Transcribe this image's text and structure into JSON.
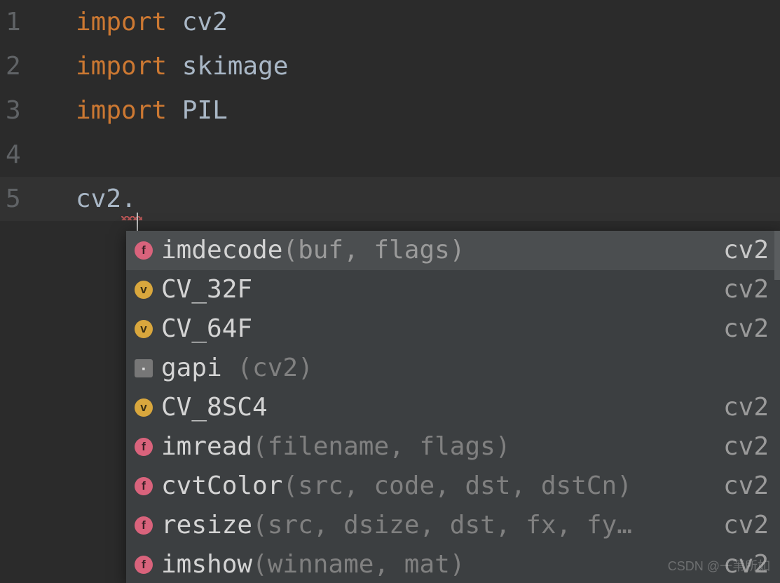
{
  "gutter": {
    "l1": "1",
    "l2": "2",
    "l3": "3",
    "l4": "4",
    "l5": "5"
  },
  "code": {
    "kw": "import",
    "sp": " ",
    "mod_cv2": "cv2",
    "mod_skimage": "skimage",
    "mod_pil": "PIL",
    "line5_prefix": "cv2",
    "line5_dot": "."
  },
  "popup": {
    "rows": [
      {
        "icon": "f",
        "icon_type": "func",
        "name": "imdecode",
        "params": "(buf, flags)",
        "origin": "cv2"
      },
      {
        "icon": "v",
        "icon_type": "var",
        "name": "CV_32F",
        "params": "",
        "origin": "cv2"
      },
      {
        "icon": "v",
        "icon_type": "var",
        "name": "CV_64F",
        "params": "",
        "origin": "cv2"
      },
      {
        "icon": "▪",
        "icon_type": "module",
        "name": "gapi",
        "params": " (cv2)",
        "origin": ""
      },
      {
        "icon": "v",
        "icon_type": "var",
        "name": "CV_8SC4",
        "params": "",
        "origin": "cv2"
      },
      {
        "icon": "f",
        "icon_type": "func",
        "name": "imread",
        "params": "(filename, flags)",
        "origin": "cv2"
      },
      {
        "icon": "f",
        "icon_type": "func",
        "name": "cvtColor",
        "params": "(src, code, dst, dstCn)",
        "origin": "cv2"
      },
      {
        "icon": "f",
        "icon_type": "func",
        "name": "resize",
        "params": "(src, dsize, dst, fx, fy…",
        "origin": "cv2"
      },
      {
        "icon": "f",
        "icon_type": "func",
        "name": "imshow",
        "params": "(winname, mat)",
        "origin": "cv2"
      }
    ]
  },
  "watermark": "CSDN @一苇所如"
}
